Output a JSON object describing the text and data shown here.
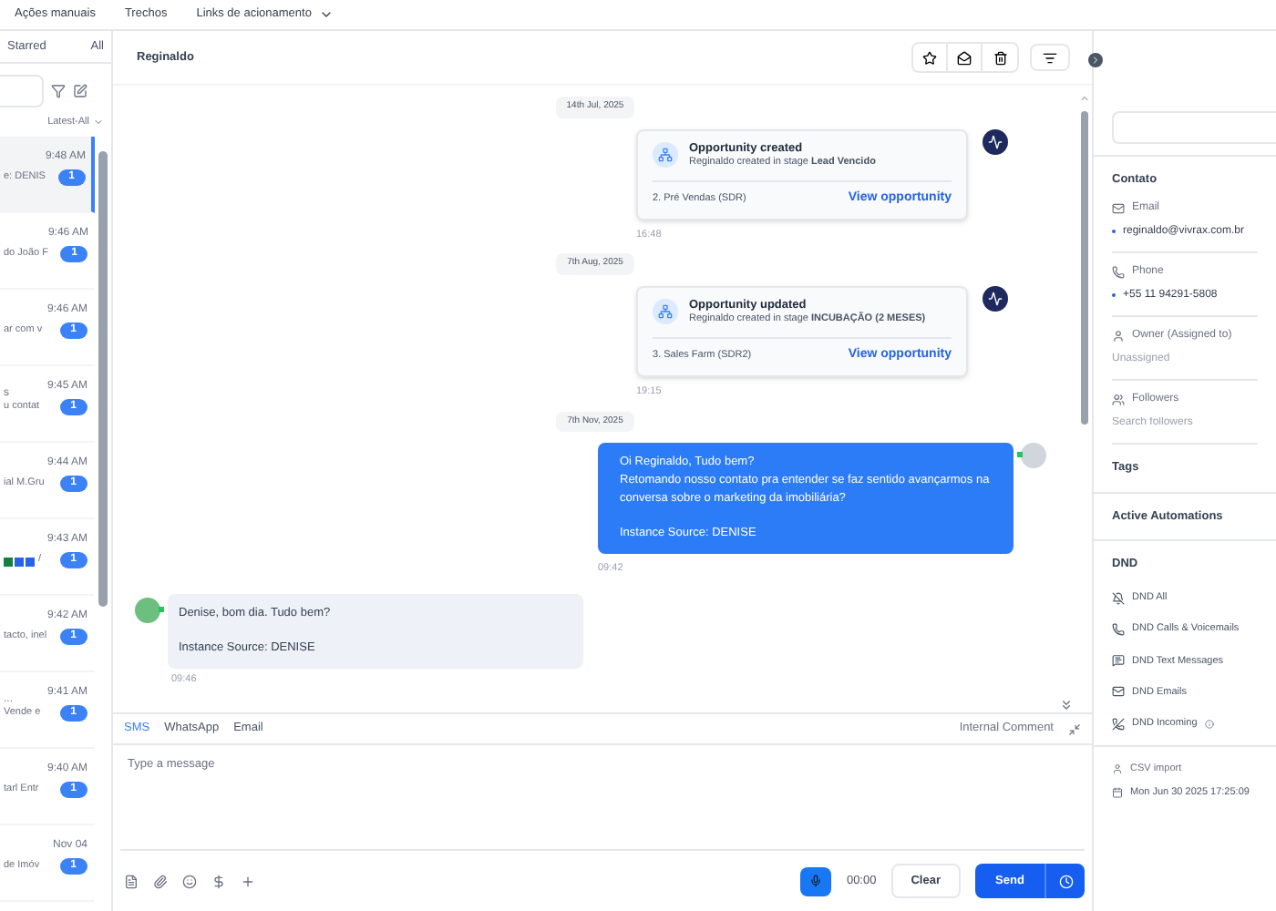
{
  "top_nav": [
    {
      "label": "Ações manuais",
      "dropdown": false
    },
    {
      "label": "Trechos",
      "dropdown": false
    },
    {
      "label": "Links de acionamento",
      "dropdown": true
    }
  ],
  "inbox": {
    "tabs": [
      {
        "label": "Starred",
        "selected": false
      },
      {
        "label": "All",
        "selected": false
      }
    ],
    "sort": "Latest-All",
    "conversations": [
      {
        "preview": "e: DENIS",
        "time": "9:48 AM",
        "badge": "1",
        "selected": true,
        "kind": "text"
      },
      {
        "preview": "do João F",
        "time": "9:46 AM",
        "badge": "1",
        "selected": false,
        "kind": "text"
      },
      {
        "preview": "ar com v",
        "time": "9:46 AM",
        "badge": "1",
        "selected": false,
        "kind": "text"
      },
      {
        "title": "s",
        "preview": "u contat",
        "time": "9:45 AM",
        "badge": "1",
        "selected": false,
        "kind": "text"
      },
      {
        "preview": "ial M.Gru",
        "time": "9:44 AM",
        "badge": "1",
        "selected": false,
        "kind": "text"
      },
      {
        "preview": "/",
        "time": "9:43 AM",
        "badge": "1",
        "selected": false,
        "kind": "emoji"
      },
      {
        "preview": "tacto, inel",
        "time": "9:42 AM",
        "badge": "1",
        "selected": false,
        "kind": "text"
      },
      {
        "title": "...",
        "preview": "Vende e",
        "time": "9:41 AM",
        "badge": "1",
        "selected": false,
        "kind": "text"
      },
      {
        "preview": "tarl Entr",
        "time": "9:40 AM",
        "badge": "1",
        "selected": false,
        "kind": "text"
      },
      {
        "preview": "de Imóv",
        "time": "Nov 04",
        "badge": "1",
        "selected": false,
        "kind": "text"
      }
    ]
  },
  "chat": {
    "contact": "Reginaldo",
    "messages": [
      {
        "kind": "date",
        "text": "14th Jul, 2025"
      },
      {
        "kind": "activity",
        "title": "Opportunity created",
        "detail": "Reginaldo created in stage **Lead Vencido**",
        "pipeline": "2. Pré Vendas (SDR)",
        "link": "View opportunity",
        "time": "16:48"
      },
      {
        "kind": "date",
        "text": "7th Aug, 2025"
      },
      {
        "kind": "activity",
        "title": "Opportunity updated",
        "detail": "Reginaldo created in stage **INCUBAÇÃO (2 MESES)**",
        "pipeline": "3. Sales Farm (SDR2)",
        "link": "View opportunity",
        "time": "19:15"
      },
      {
        "kind": "date",
        "text": "7th Nov, 2025"
      },
      {
        "kind": "outgoing",
        "paragraphs": [
          [
            "Oi Reginaldo, Tudo bem?",
            "Retomando nosso contato pra entender se faz sentido avançarmos na conversa sobre o marketing da imobiliária?"
          ],
          [
            "Instance Source: DENISE"
          ]
        ],
        "time": "09:42"
      },
      {
        "kind": "incoming",
        "paragraphs": [
          [
            "Denise, bom dia. Tudo bem?"
          ],
          [
            "Instance Source: DENISE"
          ]
        ],
        "time": "09:46"
      }
    ]
  },
  "composer": {
    "channels": [
      {
        "label": "SMS",
        "selected": true
      },
      {
        "label": "WhatsApp",
        "selected": false
      },
      {
        "label": "Email",
        "selected": false
      }
    ],
    "internal_comment": "Internal Comment",
    "placeholder": "Type a message",
    "timer": "00:00",
    "clear": "Clear",
    "send": "Send"
  },
  "contact_panel": {
    "section": "Contato",
    "fields": [
      {
        "kind": "email",
        "label": "Email",
        "value": "reginaldo@vivrax.com.br"
      },
      {
        "kind": "phone",
        "label": "Phone",
        "value": "+55 11 94291-5808"
      },
      {
        "kind": "owner",
        "label": "Owner (Assigned to)",
        "value": "Unassigned"
      },
      {
        "kind": "followers",
        "label": "Followers",
        "placeholder": "Search followers"
      }
    ],
    "sections": [
      "Tags",
      "Active Automations"
    ],
    "dnd_title": "DND",
    "dnd": [
      {
        "kind": "all",
        "label": "DND All"
      },
      {
        "kind": "calls",
        "label": "DND Calls & Voicemails"
      },
      {
        "kind": "text",
        "label": "DND Text Messages"
      },
      {
        "kind": "emails",
        "label": "DND Emails"
      },
      {
        "kind": "incoming",
        "label": "DND Incoming",
        "info": true
      }
    ],
    "source": "CSV import",
    "created": "Mon Jun 30 2025 17:25:09"
  }
}
